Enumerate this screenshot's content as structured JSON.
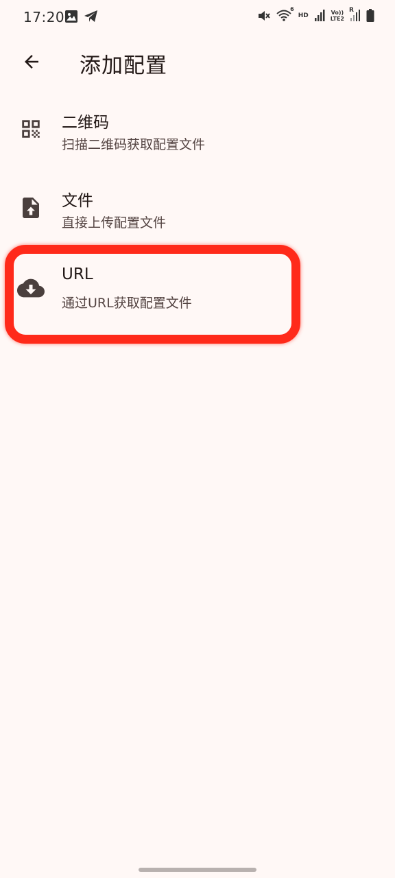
{
  "status_bar": {
    "time": "17:20",
    "hd_label": "HD",
    "volte_label": "Vo))",
    "lte_label": "LTE2",
    "roaming_label": "R",
    "wifi_badge": "6"
  },
  "app_bar": {
    "title": "添加配置",
    "back_icon": "arrow-back-icon"
  },
  "items": [
    {
      "icon": "qr-code-icon",
      "title": "二维码",
      "subtitle": "扫描二维码获取配置文件"
    },
    {
      "icon": "file-upload-icon",
      "title": "文件",
      "subtitle": "直接上传配置文件"
    },
    {
      "icon": "cloud-download-icon",
      "title": "URL",
      "subtitle": "通过URL获取配置文件"
    }
  ],
  "colors": {
    "background": "#FFF8F6",
    "icon": "#4A3F3D",
    "highlight": "#FF2A1A"
  }
}
